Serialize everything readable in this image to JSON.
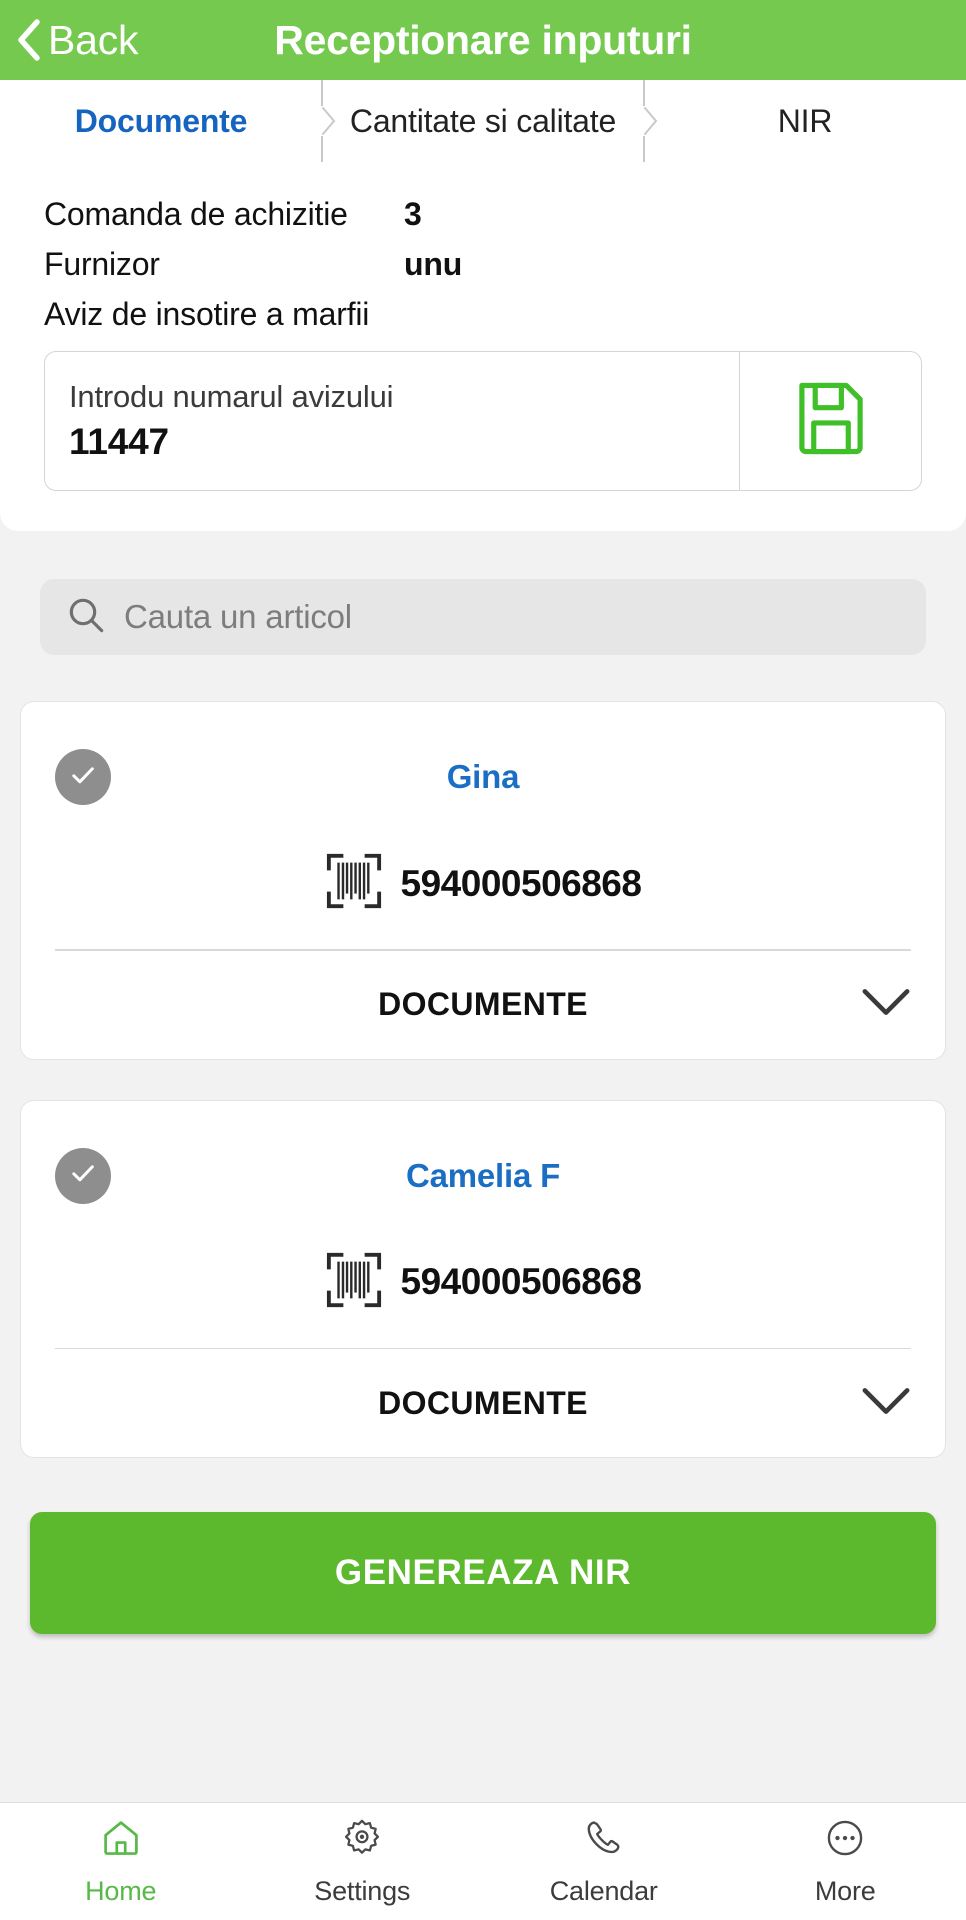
{
  "theme": {
    "header_green": "#74c94e",
    "button_green": "#5cb82c",
    "accent_blue": "#1565c0",
    "link_blue": "#1a6fc4",
    "page_background": "#f2f2f2",
    "search_background": "#e6e6e6",
    "check_circle_gray": "#8e8e8e",
    "save_icon_green": "#3fbf28",
    "nav_active_green": "#57b947"
  },
  "header": {
    "back_label": "Back",
    "back_icon": "chevron-left-icon",
    "title": "Receptionare inputuri"
  },
  "tabs": [
    {
      "label": "Documente",
      "active": true
    },
    {
      "label": "Cantitate si calitate",
      "active": false
    },
    {
      "label": "NIR",
      "active": false
    }
  ],
  "form": {
    "rows": [
      {
        "label": "Comanda de achizitie",
        "value": "3"
      },
      {
        "label": "Furnizor",
        "value": "unu"
      }
    ],
    "section_label": "Aviz de insotire a marfii",
    "aviz_input": {
      "placeholder": "Introdu numarul avizului",
      "value": "11447"
    },
    "save_icon": "floppy-save-icon"
  },
  "search": {
    "icon": "search-icon",
    "placeholder": "Cauta un articol",
    "value": ""
  },
  "articles": [
    {
      "name": "Gina",
      "checked": true,
      "check_icon": "check-circle-icon",
      "barcode_icon": "barcode-scan-icon",
      "barcode": "594000506868",
      "footer_label": "DOCUMENTE",
      "footer_icon": "chevron-down-icon"
    },
    {
      "name": "Camelia F",
      "checked": true,
      "check_icon": "check-circle-icon",
      "barcode_icon": "barcode-scan-icon",
      "barcode": "594000506868",
      "footer_label": "DOCUMENTE",
      "footer_icon": "chevron-down-icon"
    }
  ],
  "cta": {
    "label": "GENEREAZA NIR"
  },
  "bottom_nav": [
    {
      "label": "Home",
      "icon": "home-icon",
      "active": true
    },
    {
      "label": "Settings",
      "icon": "gear-icon",
      "active": false
    },
    {
      "label": "Calendar",
      "icon": "phone-icon",
      "active": false
    },
    {
      "label": "More",
      "icon": "ellipsis-circle-icon",
      "active": false
    }
  ]
}
